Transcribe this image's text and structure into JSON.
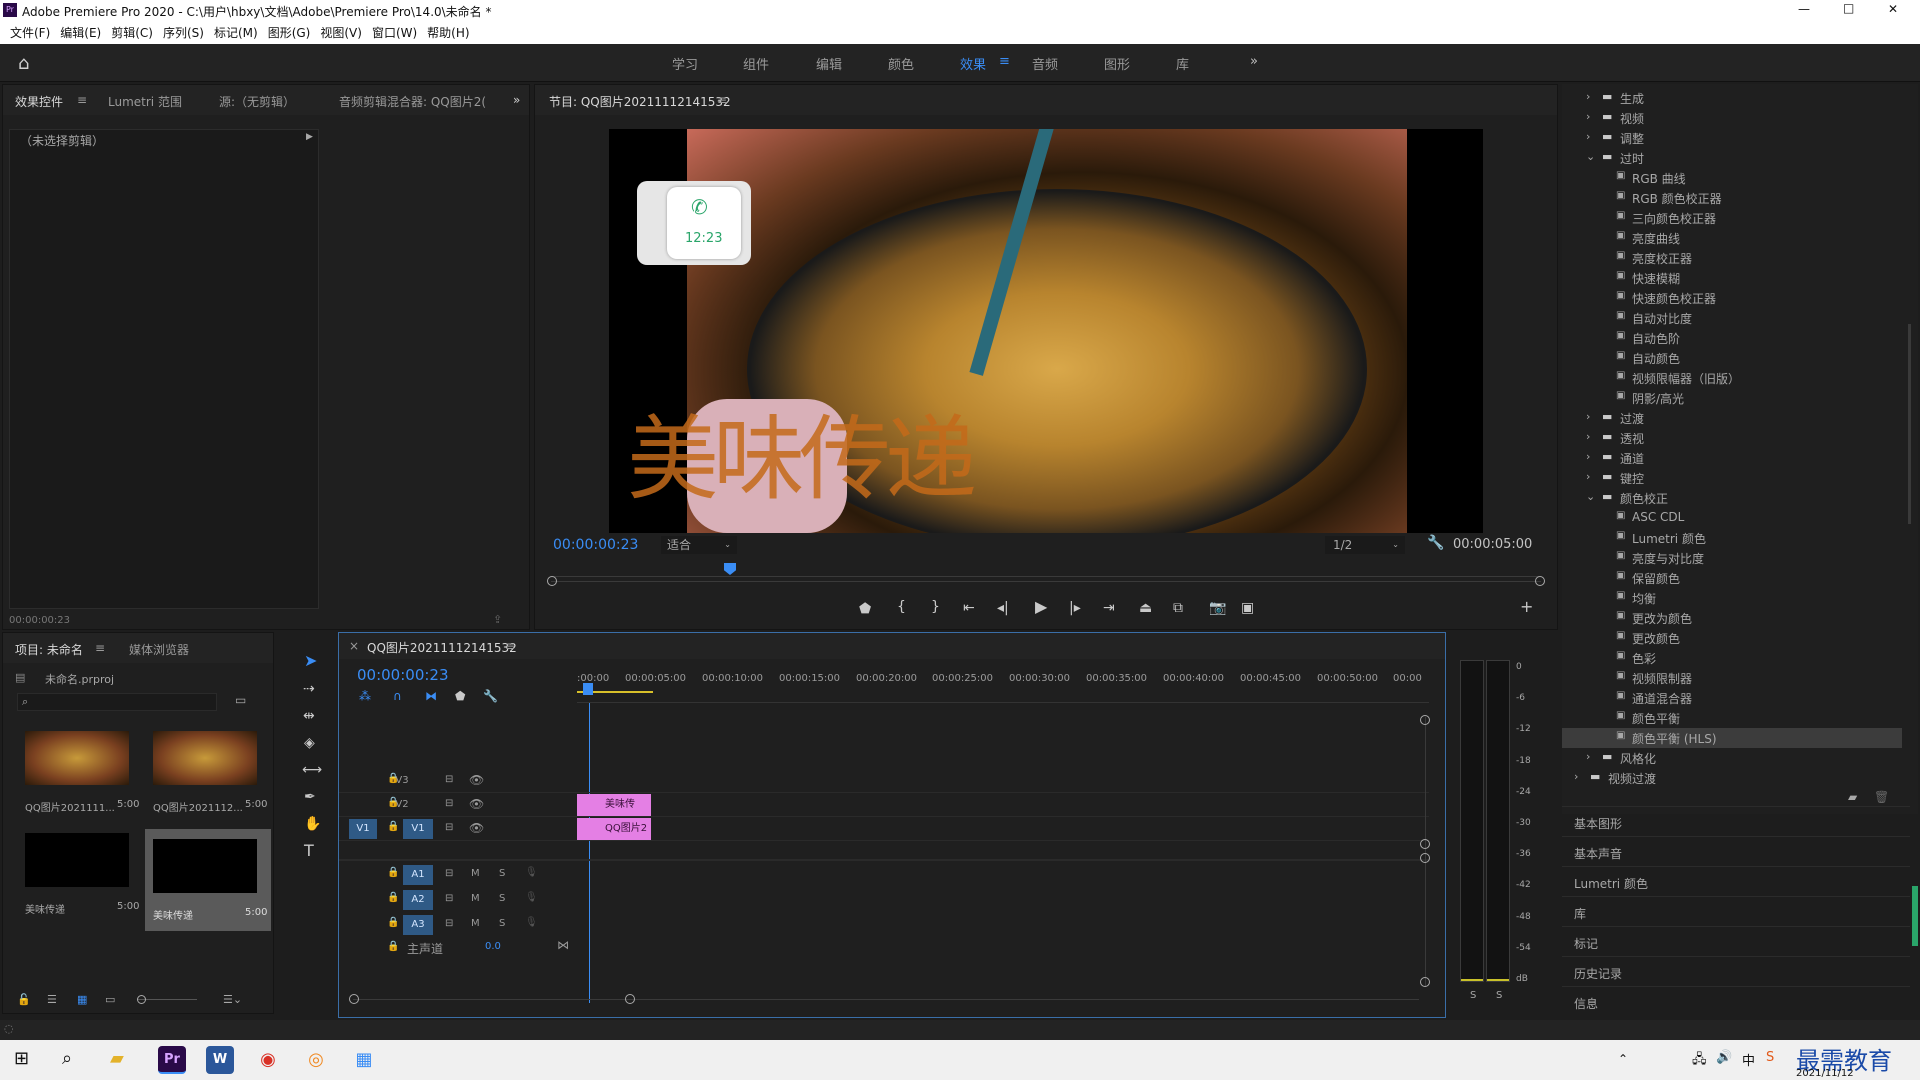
{
  "window": {
    "title": "Adobe Premiere Pro 2020 - C:\\用户\\hbxy\\文档\\Adobe\\Premiere Pro\\14.0\\未命名 *",
    "min": "—",
    "max": "□",
    "close": "✕"
  },
  "menu": [
    "文件(F)",
    "编辑(E)",
    "剪辑(C)",
    "序列(S)",
    "标记(M)",
    "图形(G)",
    "视图(V)",
    "窗口(W)",
    "帮助(H)"
  ],
  "workspaces": {
    "items": [
      "学习",
      "组件",
      "编辑",
      "颜色",
      "效果",
      "音频",
      "图形",
      "库"
    ],
    "active": "效果",
    "more": "»",
    "menu_icon": "≡"
  },
  "effect_controls": {
    "tabs": [
      "效果控件",
      "Lumetri 范围",
      "源:（无剪辑）",
      "音频剪辑混合器: QQ图片2("
    ],
    "no_clip": "（未选择剪辑）",
    "timecode": "00:00:00:23",
    "more": "»"
  },
  "program": {
    "title": "节目: QQ图片20211112141532",
    "timecode": "00:00:00:23",
    "fit": "适合",
    "res": "1/2",
    "duration": "00:00:05:00",
    "call_time": "12:23",
    "overlay_text": "美味传递",
    "playhead_fraction": 0.18
  },
  "project": {
    "tabs": [
      "项目: 未命名",
      "媒体浏览器"
    ],
    "file": "未命名.prproj",
    "items": [
      {
        "name": "QQ图片2021111...",
        "dur": "5:00"
      },
      {
        "name": "QQ图片2021112...",
        "dur": "5:00"
      },
      {
        "name": "美味传递",
        "dur": "5:00"
      },
      {
        "name": "美味传递",
        "dur": "5:00"
      }
    ]
  },
  "timeline": {
    "tab": "QQ图片20211112141532",
    "timecode": "00:00:00:23",
    "ruler": [
      ":00:00",
      "00:00:05:00",
      "00:00:10:00",
      "00:00:15:00",
      "00:00:20:00",
      "00:00:25:00",
      "00:00:30:00",
      "00:00:35:00",
      "00:00:40:00",
      "00:00:45:00",
      "00:00:50:00",
      "00:00"
    ],
    "video_tracks": [
      "V3",
      "V2",
      "V1"
    ],
    "audio_tracks": [
      "A1",
      "A2",
      "A3"
    ],
    "master": "主声道",
    "master_value": "0.0",
    "src_v": "V1",
    "m": "M",
    "s": "S",
    "clips": [
      {
        "track": "V2",
        "label": "美味传"
      },
      {
        "track": "V1",
        "label": "QQ图片2"
      }
    ]
  },
  "meter": {
    "ticks": [
      "0",
      "-6",
      "-12",
      "-18",
      "-24",
      "-30",
      "-36",
      "-42",
      "-48",
      "-54",
      "dB"
    ],
    "solo": [
      "S",
      "S"
    ]
  },
  "effects": {
    "tree": [
      {
        "d": 1,
        "t": "folder",
        "label": "生成",
        "open": false
      },
      {
        "d": 1,
        "t": "folder",
        "label": "视频",
        "open": false
      },
      {
        "d": 1,
        "t": "folder",
        "label": "调整",
        "open": false
      },
      {
        "d": 1,
        "t": "folder",
        "label": "过时",
        "open": true
      },
      {
        "d": 2,
        "t": "fx",
        "label": "RGB 曲线"
      },
      {
        "d": 2,
        "t": "fx",
        "label": "RGB 颜色校正器"
      },
      {
        "d": 2,
        "t": "fx",
        "label": "三向颜色校正器"
      },
      {
        "d": 2,
        "t": "fx",
        "label": "亮度曲线"
      },
      {
        "d": 2,
        "t": "fx",
        "label": "亮度校正器"
      },
      {
        "d": 2,
        "t": "fx",
        "label": "快速模糊"
      },
      {
        "d": 2,
        "t": "fx",
        "label": "快速颜色校正器"
      },
      {
        "d": 2,
        "t": "fx",
        "label": "自动对比度"
      },
      {
        "d": 2,
        "t": "fx",
        "label": "自动色阶"
      },
      {
        "d": 2,
        "t": "fx",
        "label": "自动颜色"
      },
      {
        "d": 2,
        "t": "fx",
        "label": "视频限幅器（旧版）"
      },
      {
        "d": 2,
        "t": "fx",
        "label": "阴影/高光"
      },
      {
        "d": 1,
        "t": "folder",
        "label": "过渡",
        "open": false
      },
      {
        "d": 1,
        "t": "folder",
        "label": "透视",
        "open": false
      },
      {
        "d": 1,
        "t": "folder",
        "label": "通道",
        "open": false
      },
      {
        "d": 1,
        "t": "folder",
        "label": "键控",
        "open": false
      },
      {
        "d": 1,
        "t": "folder",
        "label": "颜色校正",
        "open": true
      },
      {
        "d": 2,
        "t": "fx",
        "label": "ASC CDL"
      },
      {
        "d": 2,
        "t": "fx",
        "label": "Lumetri 颜色"
      },
      {
        "d": 2,
        "t": "fx",
        "label": "亮度与对比度"
      },
      {
        "d": 2,
        "t": "fx",
        "label": "保留颜色"
      },
      {
        "d": 2,
        "t": "fx",
        "label": "均衡"
      },
      {
        "d": 2,
        "t": "fx",
        "label": "更改为颜色"
      },
      {
        "d": 2,
        "t": "fx",
        "label": "更改颜色"
      },
      {
        "d": 2,
        "t": "fx",
        "label": "色彩"
      },
      {
        "d": 2,
        "t": "fx",
        "label": "视频限制器"
      },
      {
        "d": 2,
        "t": "fx",
        "label": "通道混合器"
      },
      {
        "d": 2,
        "t": "fx",
        "label": "颜色平衡"
      },
      {
        "d": 2,
        "t": "fx",
        "label": "颜色平衡 (HLS)",
        "selected": true
      },
      {
        "d": 1,
        "t": "folder",
        "label": "风格化",
        "open": false
      },
      {
        "d": 0,
        "t": "folder",
        "label": "视频过渡",
        "open": false
      }
    ],
    "panels": [
      "基本图形",
      "基本声音",
      "Lumetri 颜色",
      "库",
      "标记",
      "历史记录",
      "信息"
    ]
  },
  "taskbar": {
    "date": "2021/11/12",
    "watermark": "最需教育",
    "apps": [
      "Pr",
      "W",
      "◉",
      "◎",
      "▦"
    ],
    "ime": "中"
  }
}
